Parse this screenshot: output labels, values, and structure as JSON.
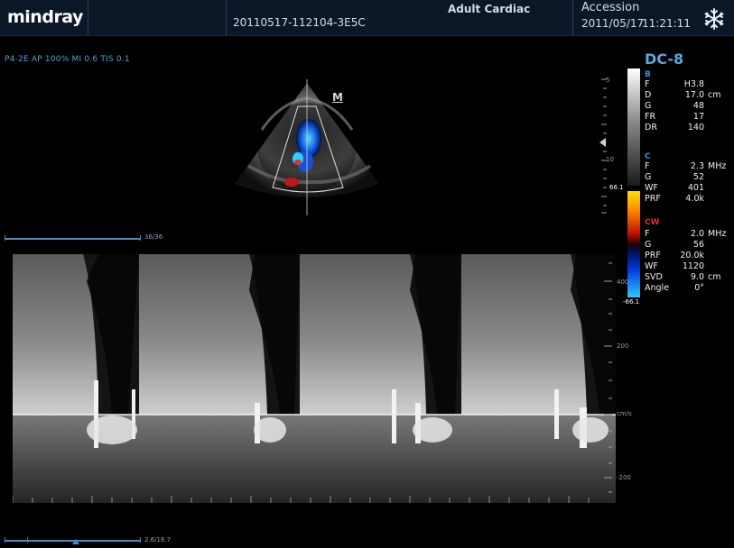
{
  "header": {
    "logo": "mindray",
    "patient_id": "20110517-112104-3E5C",
    "exam_type": "Adult Cardiac",
    "accession_label": "Accession",
    "date": "2011/05/17",
    "time": "11:21:11",
    "freeze_icon": "snowflake-icon"
  },
  "imaging": {
    "probe_params": "P4-2E  AP 100%  MI 0.6 TIS 0.1",
    "m_marker": "M",
    "depth_labels": [
      "5",
      "10",
      "15"
    ]
  },
  "colorbar": {
    "top_value": "66.1",
    "bottom_value": "-66.1"
  },
  "panel": {
    "title": "DC-8",
    "b_mode": {
      "label": "B",
      "color": "#3f8fd8",
      "rows": [
        {
          "key": "F",
          "value": "H3.8",
          "unit": ""
        },
        {
          "key": "D",
          "value": "17.0",
          "unit": "cm"
        },
        {
          "key": "G",
          "value": "48",
          "unit": ""
        },
        {
          "key": "FR",
          "value": "17",
          "unit": ""
        },
        {
          "key": "DR",
          "value": "140",
          "unit": ""
        }
      ]
    },
    "color_mode": {
      "label": "C",
      "color": "#3f8fd8",
      "rows": [
        {
          "key": "F",
          "value": "2.3",
          "unit": "MHz"
        },
        {
          "key": "G",
          "value": "52",
          "unit": ""
        },
        {
          "key": "WF",
          "value": "401",
          "unit": ""
        },
        {
          "key": "PRF",
          "value": "4.0k",
          "unit": ""
        }
      ]
    },
    "cw_mode": {
      "label": "CW",
      "color": "#e03030",
      "rows": [
        {
          "key": "F",
          "value": "2.0",
          "unit": "MHz"
        },
        {
          "key": "G",
          "value": "56",
          "unit": ""
        },
        {
          "key": "PRF",
          "value": "20.0k",
          "unit": ""
        },
        {
          "key": "WF",
          "value": "1120",
          "unit": ""
        },
        {
          "key": "SVD",
          "value": "9.0",
          "unit": "cm"
        },
        {
          "key": "Angle",
          "value": "0°",
          "unit": ""
        }
      ]
    }
  },
  "timeline_2d": {
    "label": "36/36"
  },
  "timeline_spectrum": {
    "label": "2.6/16.7"
  },
  "spectrum_scale": {
    "labels": [
      "400",
      "200",
      "cm/s",
      "-200"
    ]
  }
}
